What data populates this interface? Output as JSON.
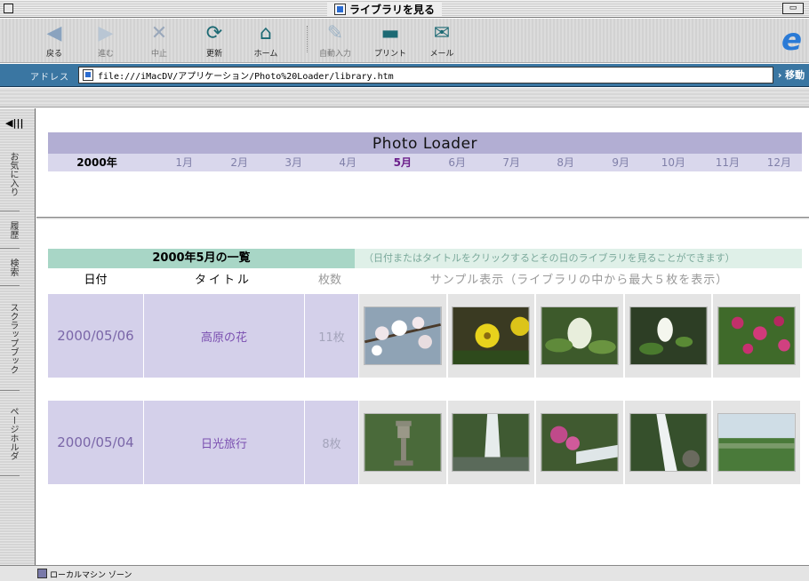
{
  "window": {
    "title": "ライブラリを見る"
  },
  "toolbar": {
    "back": "戻る",
    "forward": "進む",
    "stop": "中止",
    "refresh": "更新",
    "home": "ホーム",
    "autofill": "自動入力",
    "print": "プリント",
    "mail": "メール"
  },
  "address": {
    "label": "アドレス",
    "url": "file:///iMacDV/アプリケーション/Photo%20Loader/library.htm",
    "go": "› 移動"
  },
  "sidebar": {
    "tabs": [
      "お気に入り",
      "履歴",
      "検索",
      "スクラップブック",
      "ページホルダ"
    ]
  },
  "calendar": {
    "title": "Photo Loader",
    "year": "2000年",
    "months": [
      "1月",
      "2月",
      "3月",
      "4月",
      "5月",
      "6月",
      "7月",
      "8月",
      "9月",
      "10月",
      "11月",
      "12月"
    ],
    "active_month": "5月"
  },
  "list": {
    "title": "2000年5月の一覧",
    "hint": "（日付またはタイトルをクリックするとその日のライブラリを見ることができます）",
    "col_date": "日付",
    "col_title": "タイトル",
    "col_count": "枚数",
    "col_sample": "サンプル表示（ライブラリの中から最大５枚を表示）",
    "albums": [
      {
        "date": "2000/05/06",
        "title": "高原の花",
        "count": "11枚",
        "thumbs": [
          "cherry-blossom",
          "yellow-flowers",
          "skunk-cabbage",
          "white-flower",
          "pink-azalea"
        ]
      },
      {
        "date": "2000/05/04",
        "title": "日光旅行",
        "count": "8枚",
        "thumbs": [
          "stone-lantern",
          "waterfall",
          "azalea-stream",
          "cascade",
          "marsh"
        ]
      }
    ]
  },
  "status": {
    "text": "ローカルマシン ゾーン"
  },
  "colors": {
    "header_purple": "#b2aed3",
    "list_green": "#a8d6c6",
    "row_lavender": "#d4d0ea",
    "address_blue": "#3a76a2"
  }
}
